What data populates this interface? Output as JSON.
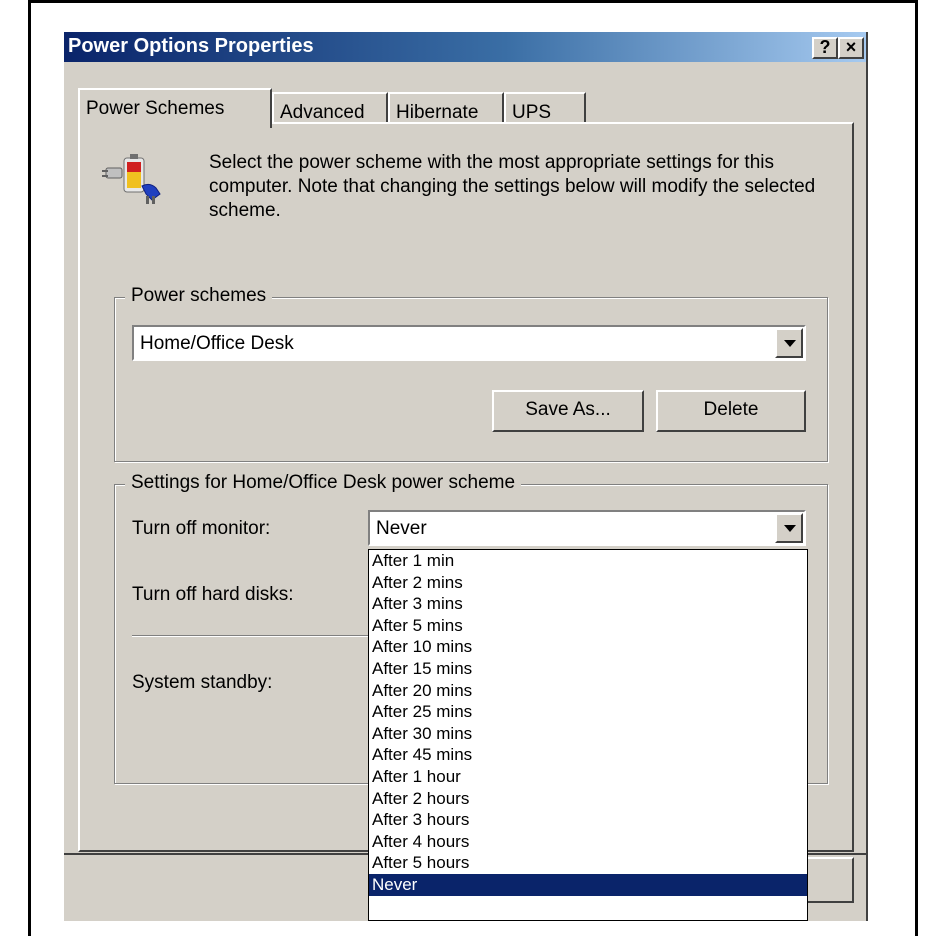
{
  "window": {
    "title": "Power Options Properties",
    "help_glyph": "?",
    "close_glyph": "×"
  },
  "tabs": [
    {
      "label": "Power Schemes",
      "active": true
    },
    {
      "label": "Advanced",
      "active": false
    },
    {
      "label": "Hibernate",
      "active": false
    },
    {
      "label": "UPS",
      "active": false
    }
  ],
  "intro_text": "Select the power scheme with the most appropriate settings for this computer. Note that changing the settings below will modify the selected scheme.",
  "power_schemes": {
    "legend": "Power schemes",
    "selected": "Home/Office Desk",
    "save_as_label": "Save As...",
    "delete_label": "Delete"
  },
  "settings": {
    "legend": "Settings for Home/Office Desk power scheme",
    "monitor_label": "Turn off monitor:",
    "monitor_value": "Never",
    "disks_label": "Turn off hard disks:",
    "standby_label": "System standby:"
  },
  "dropdown": {
    "items": [
      "After 1 min",
      "After 2 mins",
      "After 3 mins",
      "After 5 mins",
      "After 10 mins",
      "After 15 mins",
      "After 20 mins",
      "After 25 mins",
      "After 30 mins",
      "After 45 mins",
      "After 1 hour",
      "After 2 hours",
      "After 3 hours",
      "After 4 hours",
      "After 5 hours",
      "Never"
    ],
    "selected_item": "Never"
  },
  "icons": {
    "scheme_icon": "power-plug-battery-icon",
    "dropdown_arrow": "chevron-down-icon"
  },
  "colors": {
    "title_gradient_start": "#0a246a",
    "title_gradient_end": "#a6caf0",
    "selection": "#0a246a",
    "face": "#d4d0c8"
  }
}
